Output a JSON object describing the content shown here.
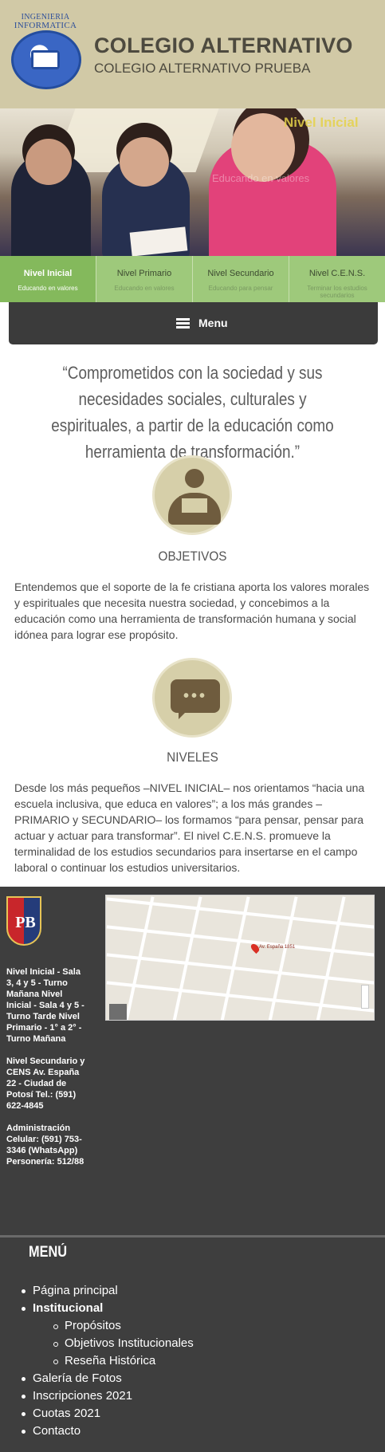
{
  "header": {
    "logo_text_line1": "INGENIERIA",
    "logo_text_line2": "INFORMATICA",
    "site_title": "COLEGIO ALTERNATIVO",
    "site_subtitle": "COLEGIO ALTERNATIVO PRUEBA"
  },
  "hero": {
    "overlay_title": "Nivel Inicial",
    "overlay_sub": "Educando en valores"
  },
  "levels": [
    {
      "title": "Nivel Inicial",
      "subtitle": "Educando en valores",
      "active": true
    },
    {
      "title": "Nivel Primario",
      "subtitle": "Educando en valores",
      "active": false
    },
    {
      "title": "Nivel Secundario",
      "subtitle": "Educando para pensar",
      "active": false
    },
    {
      "title": "Nivel C.E.N.S.",
      "subtitle": "Terminar los estudios secundarios",
      "active": false
    }
  ],
  "menu_button": {
    "label": "Menu"
  },
  "quote": "“Comprometidos con la sociedad y sus necesidades sociales, culturales y espirituales, a partir de la educación como herramienta de transformación.”",
  "sections": [
    {
      "title": "OBJETIVOS",
      "icon": "reader-icon",
      "text": "Entendemos que el soporte de la fe cristiana aporta los valores morales y espirituales que necesita nuestra sociedad, y concebimos a la educación como una herramienta de transformación humana y social idónea para lograr ese propósito."
    },
    {
      "title": "NIVELES",
      "icon": "chat-icon",
      "text": "Desde los más pequeños –NIVEL INICIAL– nos orientamos “hacia una escuela inclusiva, que educa en valores”; a los más grandes –PRIMARIO y SECUNDARIO– los formamos “para pensar, pensar para actuar y actuar para transformar”. El nivel C.E.N.S. promueve la terminalidad de los estudios secundarios para insertarse en el campo laboral o continuar los estudios universitarios."
    }
  ],
  "footer": {
    "shield_letters": "PB",
    "map_pin_label": "Av. España 1851",
    "info_block1": "Nivel Inicial - Sala 3, 4 y 5 - Turno Mañana Nivel Inicial - Sala 4 y 5 - Turno Tarde Nivel Primario - 1° a 2° - Turno Mañana",
    "info_block2": "Nivel Secundario y CENS Av. España 22 - Ciudad de Potosí Tel.: (591) 622-4845",
    "info_block3": "Administración Celular: (591) 753-3346 (WhatsApp) Personería: 512/88"
  },
  "footer_menu": {
    "title": "MENÚ",
    "items": [
      {
        "label": "Página principal",
        "level": 0,
        "bold": false
      },
      {
        "label": "Institucional",
        "level": 0,
        "bold": true
      },
      {
        "label": "Propósitos",
        "level": 1,
        "bold": false
      },
      {
        "label": "Objetivos Institucionales",
        "level": 1,
        "bold": false
      },
      {
        "label": "Reseña Histórica",
        "level": 1,
        "bold": false
      },
      {
        "label": "Galería de Fotos",
        "level": 0,
        "bold": false
      },
      {
        "label": "Inscripciones 2021",
        "level": 0,
        "bold": false
      },
      {
        "label": "Cuotas 2021",
        "level": 0,
        "bold": false
      },
      {
        "label": "Contacto",
        "level": 0,
        "bold": false
      }
    ]
  },
  "colors": {
    "header_bg": "#d1c9a6",
    "tab_green": "#9ec97b",
    "tab_active": "#84b95c",
    "menu_dark": "#3b3b3b",
    "footer_bg": "#3e3e3e",
    "circle_bg": "#d6cfa9",
    "icon_brown": "#6f5c3e"
  }
}
